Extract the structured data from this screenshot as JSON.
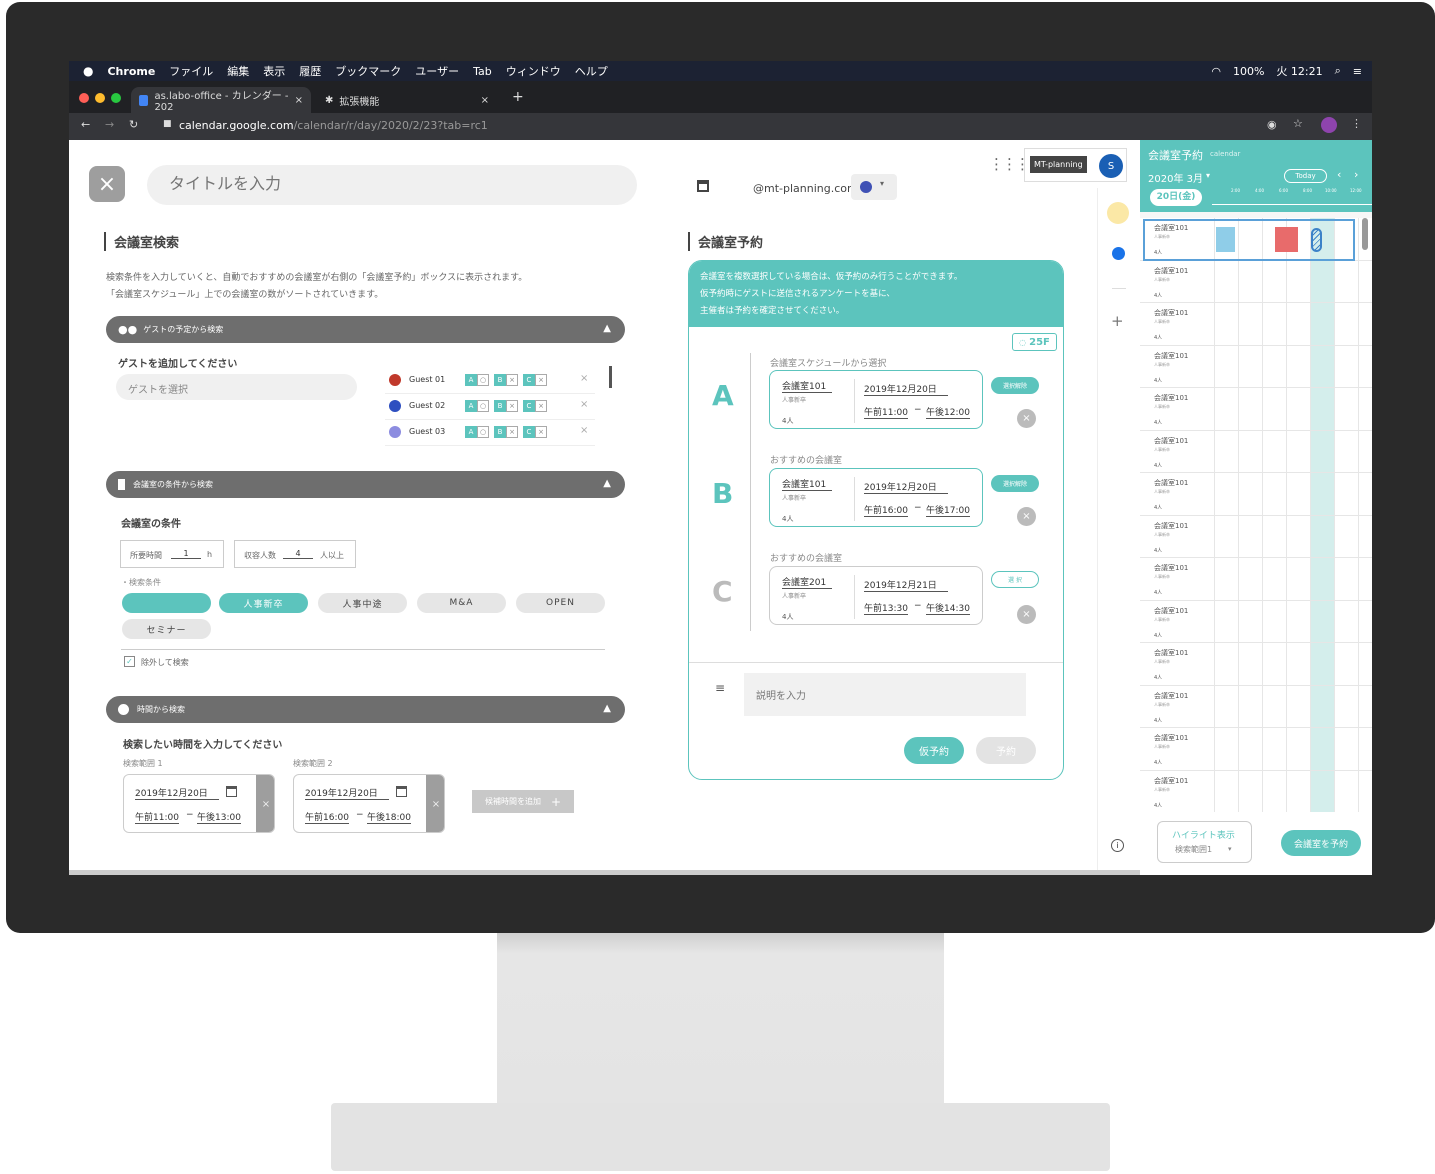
{
  "menubar": {
    "app": "Chrome",
    "items": [
      "ファイル",
      "編集",
      "表示",
      "履歴",
      "ブックマーク",
      "ユーザー",
      "Tab",
      "ウィンドウ",
      "ヘルプ"
    ],
    "battery": "100%",
    "clock": "火 12:21"
  },
  "tabs": [
    {
      "label": "as.labo-office - カレンダー - 202"
    },
    {
      "label": "拡張機能"
    }
  ],
  "address": {
    "host": "calendar.google.com",
    "path": "/calendar/r/day/2020/2/23?tab=rc1"
  },
  "header": {
    "title_placeholder": "タイトルを入力",
    "account": "@mt-planning.com",
    "org_button": "MT-planning",
    "avatar": "S"
  },
  "search": {
    "heading": "会議室検索",
    "desc1": "検索条件を入力していくと、自動でおすすめの会議室が右側の「会議室予約」ボックスに表示されます。",
    "desc2": "「会議室スケジュール」上での会議室の数がソートされていきます。",
    "guest_section": "ゲストの予定から検索",
    "guest_prompt": "ゲストを追加してください",
    "guest_placeholder": "ゲストを選択",
    "guests": [
      {
        "name": "Guest 01",
        "color": "#c0392b"
      },
      {
        "name": "Guest 02",
        "color": "#2e4fc0"
      },
      {
        "name": "Guest 03",
        "color": "#8c8ce0"
      }
    ],
    "slot_marks": [
      "A",
      "○",
      "B",
      "×",
      "C",
      "×"
    ],
    "room_section": "会議室の条件から検索",
    "room_cond_label": "会議室の条件",
    "duration_label": "所要時間",
    "duration_value": "1",
    "duration_unit": "h",
    "capacity_label": "収容人数",
    "capacity_value": "4",
    "capacity_unit": "人以上",
    "filter_label": "・検索条件",
    "tags": [
      "",
      "人事新卒",
      "人事中途",
      "M&A",
      "OPEN",
      "セミナー"
    ],
    "exclude_label": "除外して検索",
    "time_section": "時間から検索",
    "time_prompt": "検索したい時間を入力してください",
    "ranges": [
      {
        "label": "検索範囲 1",
        "date": "2019年12月20日",
        "start": "午前11:00",
        "end": "午後13:00"
      },
      {
        "label": "検索範囲 2",
        "date": "2019年12月20日",
        "start": "午前16:00",
        "end": "午後18:00"
      }
    ],
    "add_range": "候補時間を追加"
  },
  "reserve": {
    "heading": "会議室予約",
    "notice1": "会議室を複数選択している場合は、仮予約のみ行うことができます。",
    "notice2": "仮予約時にゲストに送信されるアンケートを基に、",
    "notice3": "主催者は予約を確定させてください。",
    "floor": "25F",
    "items": [
      {
        "letter": "A",
        "section": "会議室スケジュールから選択",
        "room": "会議室101",
        "dept": "人事新卒",
        "cap": "4人",
        "date": "2019年12月20日",
        "start": "午前11:00",
        "end": "午後12:00",
        "action": "選択解除"
      },
      {
        "letter": "B",
        "section": "おすすめの会議室",
        "room": "会議室101",
        "dept": "人事新卒",
        "cap": "4人",
        "date": "2019年12月20日",
        "start": "午前16:00",
        "end": "午後17:00",
        "action": "選択解除"
      },
      {
        "letter": "C",
        "section": "おすすめの会議室",
        "room": "会議室201",
        "dept": "人事新卒",
        "cap": "4人",
        "date": "2019年12月21日",
        "start": "午前13:30",
        "end": "午後14:30",
        "action": "選 択"
      }
    ],
    "desc_placeholder": "説明を入力",
    "tentative": "仮予約",
    "confirm": "予約"
  },
  "sidebar": {
    "title": "会議室予約",
    "subtitle": "calendar",
    "month": "2020年 3月",
    "today": "Today",
    "day": "20日(金)",
    "hours": [
      "2:00",
      "4:00",
      "6:00",
      "8:00",
      "10:00",
      "12:00"
    ],
    "room": "会議室101",
    "dept": "人事新卒",
    "cap": "4人",
    "highlight": "ハイライト表示",
    "range_select": "検索範囲1",
    "book": "会議室を予約"
  }
}
